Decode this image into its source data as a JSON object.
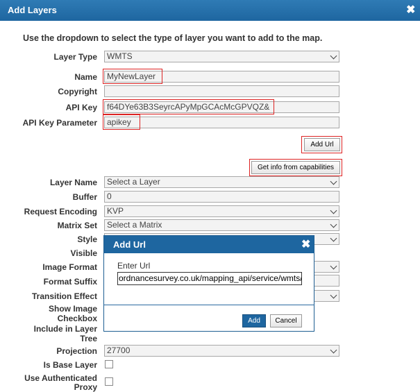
{
  "window": {
    "title": "Add Layers",
    "close_glyph": "✖"
  },
  "intro": "Use the dropdown to select the type of layer you want to add to the map.",
  "form": {
    "layer_type": {
      "label": "Layer Type",
      "value": "WMTS"
    },
    "name": {
      "label": "Name",
      "value": "MyNewLayer"
    },
    "copyright": {
      "label": "Copyright",
      "value": ""
    },
    "api_key": {
      "label": "API Key",
      "value": "f64DYe63B3SeyrcAPyMpGCAcMcGPVQZ&"
    },
    "api_key_param": {
      "label": "API Key Parameter",
      "value": "apikey"
    },
    "add_url_button": "Add Url",
    "get_info_button": "Get info from capabilities",
    "layer_name": {
      "label": "Layer Name",
      "value": "Select a Layer"
    },
    "buffer": {
      "label": "Buffer",
      "value": "0"
    },
    "request_encoding": {
      "label": "Request Encoding",
      "value": "KVP"
    },
    "matrix_set": {
      "label": "Matrix Set",
      "value": "Select a Matrix"
    },
    "style": {
      "label": "Style",
      "value": ""
    },
    "visible": {
      "label": "Visible"
    },
    "image_format": {
      "label": "Image Format",
      "value": ""
    },
    "format_suffix": {
      "label": "Format Suffix",
      "value": ""
    },
    "transition_effect": {
      "label": "Transition Effect",
      "value": ""
    },
    "show_image_checkbox": {
      "label1": "Show Image",
      "label2": "Checkbox"
    },
    "include_in_layer_tree": {
      "label1": "Include in Layer",
      "label2": "Tree"
    },
    "projection": {
      "label": "Projection",
      "value": "27700"
    },
    "is_base_layer": {
      "label": "Is Base Layer"
    },
    "use_authenticated_proxy": {
      "label1": "Use Authenticated",
      "label2": "Proxy"
    }
  },
  "dialog": {
    "title": "Add Url",
    "close_glyph": "✖",
    "label": "Enter Url",
    "url_value": "ordnancesurvey.co.uk/mapping_api/service/wmts/",
    "add_label": "Add",
    "cancel_label": "Cancel"
  },
  "colors": {
    "titlebar": "#1e66a0",
    "highlight": "#dd2222"
  }
}
